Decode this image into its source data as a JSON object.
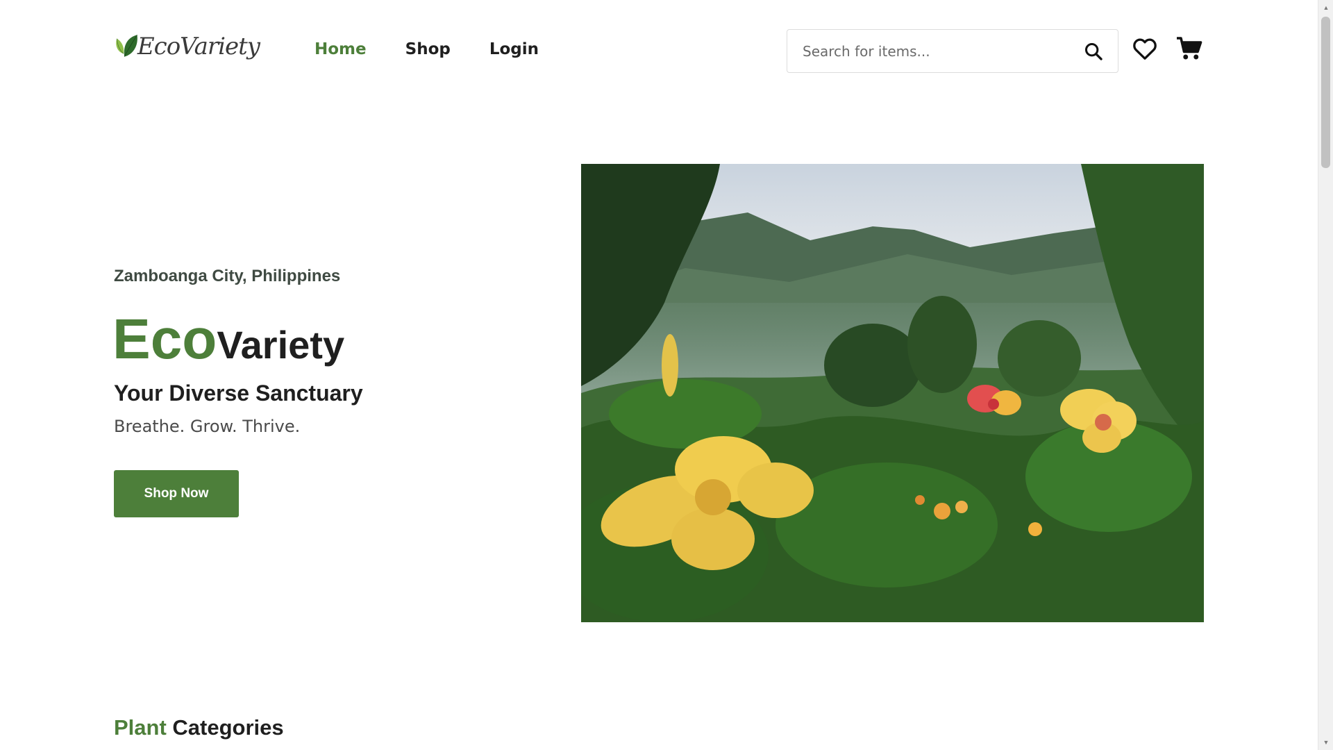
{
  "header": {
    "logo_text": "EcoVariety",
    "nav": [
      {
        "label": "Home",
        "active": true
      },
      {
        "label": "Shop",
        "active": false
      },
      {
        "label": "Login",
        "active": false
      }
    ],
    "search": {
      "placeholder": "Search for items...",
      "value": ""
    },
    "icons": {
      "search": "search-icon",
      "wishlist": "heart-icon",
      "cart": "cart-icon"
    }
  },
  "hero": {
    "location": "Zamboanga City, Philippines",
    "title_accent": "Eco",
    "title_rest": "Variety",
    "subtitle": "Your Diverse Sanctuary",
    "tagline": "Breathe. Grow. Thrive.",
    "cta_label": "Shop Now",
    "image_alt": "Misty tropical forest with yellow flowers"
  },
  "categories": {
    "heading_accent": "Plant",
    "heading_rest": " Categories"
  },
  "colors": {
    "brand_green": "#4d7f3a",
    "text_dark": "#1f1f1f"
  }
}
